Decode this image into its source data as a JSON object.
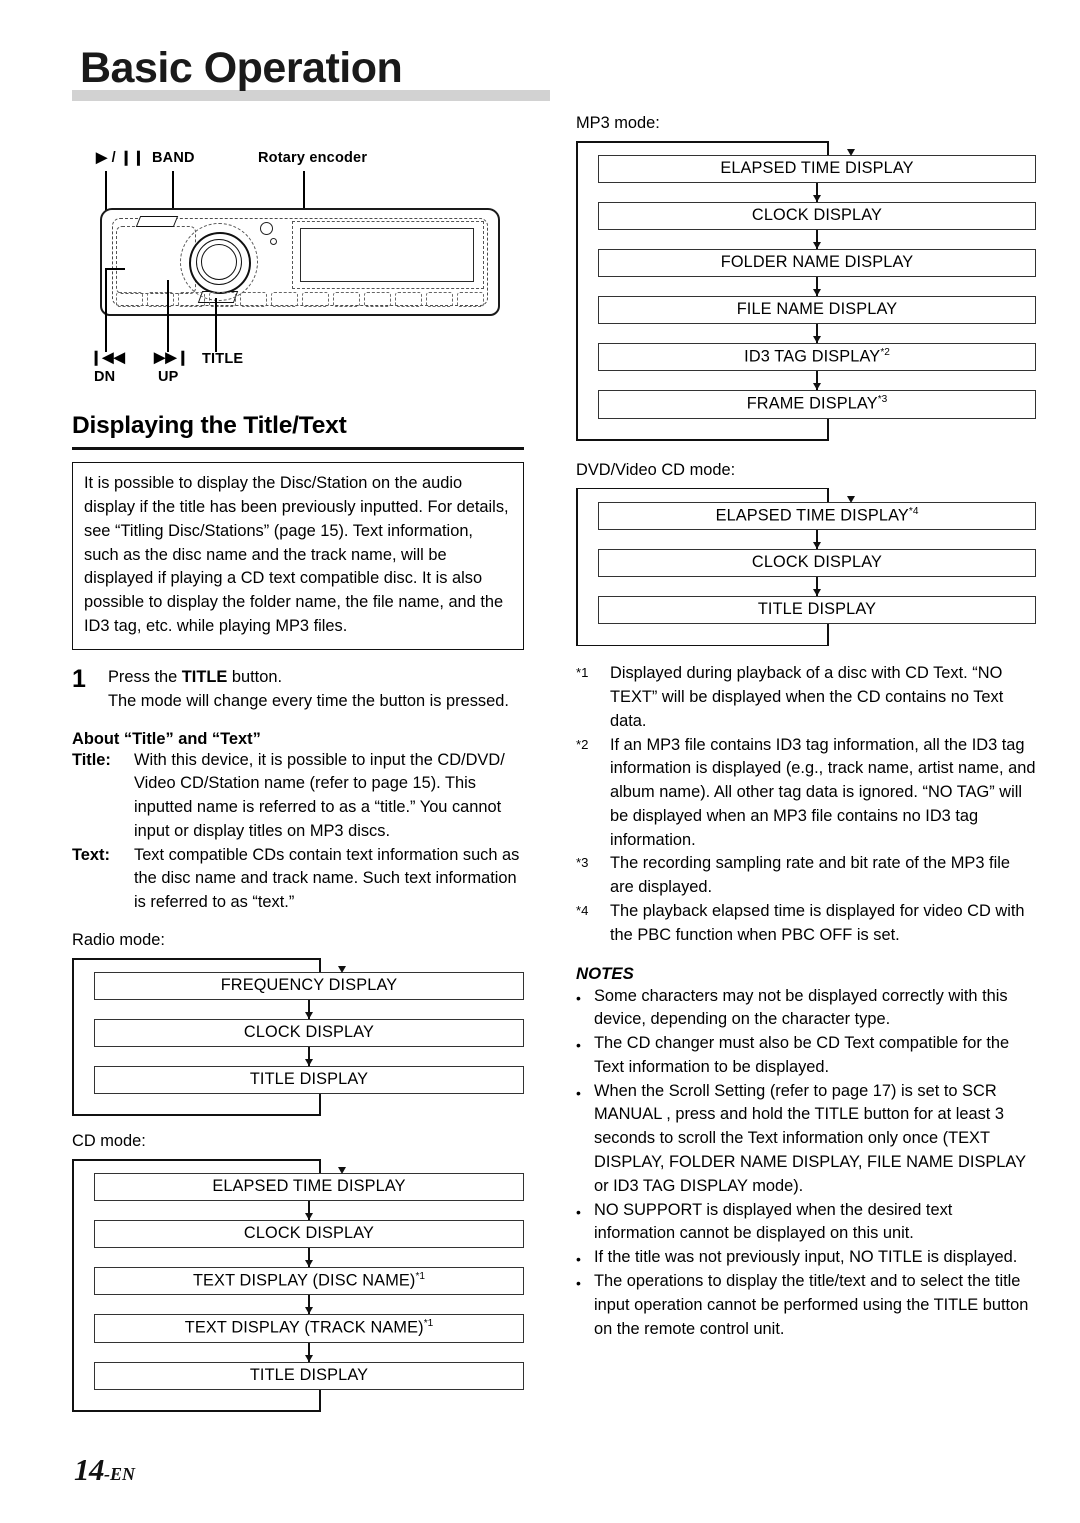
{
  "header": {
    "title": "Basic Operation"
  },
  "figure": {
    "labels": {
      "play_pause": "▶ / ❙❙",
      "band": "BAND",
      "rotary_encoder": "Rotary encoder",
      "prev": "❙◀◀",
      "prev_sub": "DN",
      "next": "▶▶❙",
      "next_sub": "UP",
      "title": "TITLE"
    }
  },
  "section": {
    "heading": "Displaying the Title/Text",
    "intro": "It is possible to display the Disc/Station on the audio display if the title has been previously inputted. For details, see “Titling Disc/Stations” (page 15). Text information, such as the disc name and the track name, will be displayed if playing a CD text compatible disc. It is also possible to display the folder name, the file name, and the ID3 tag, etc. while playing MP3 files."
  },
  "step1": {
    "number": "1",
    "line1_pre": "Press the ",
    "line1_bold": "TITLE",
    "line1_post": " button.",
    "line2": "The mode will change every time the button is pressed."
  },
  "about": {
    "heading": "About “Title” and “Text”",
    "rows": [
      {
        "term": "Title:",
        "desc": "With this device, it is possible to input the CD/DVD/ Video CD/Station name (refer to page 15). This inputted name is referred to as a “title.” You cannot input or display titles on MP3 discs."
      },
      {
        "term": "Text:",
        "desc": "Text compatible CDs contain text information such as the disc name and track name. Such text information is referred to as “text.”"
      }
    ]
  },
  "flows": {
    "radio": {
      "caption": "Radio mode:",
      "boxes": [
        {
          "label": "FREQUENCY DISPLAY",
          "sup": ""
        },
        {
          "label": "CLOCK DISPLAY",
          "sup": ""
        },
        {
          "label": "TITLE DISPLAY",
          "sup": ""
        }
      ]
    },
    "cd": {
      "caption": "CD mode:",
      "boxes": [
        {
          "label": "ELAPSED TIME DISPLAY",
          "sup": ""
        },
        {
          "label": "CLOCK DISPLAY",
          "sup": ""
        },
        {
          "label": "TEXT DISPLAY (DISC NAME)",
          "sup": "*1"
        },
        {
          "label": "TEXT DISPLAY (TRACK NAME)",
          "sup": "*1"
        },
        {
          "label": "TITLE DISPLAY",
          "sup": ""
        }
      ]
    },
    "mp3": {
      "caption": "MP3 mode:",
      "boxes": [
        {
          "label": "ELAPSED TIME DISPLAY",
          "sup": ""
        },
        {
          "label": "CLOCK DISPLAY",
          "sup": ""
        },
        {
          "label": "FOLDER NAME DISPLAY",
          "sup": ""
        },
        {
          "label": "FILE NAME DISPLAY",
          "sup": ""
        },
        {
          "label": "ID3 TAG DISPLAY",
          "sup": "*2"
        },
        {
          "label": "FRAME DISPLAY",
          "sup": "*3"
        }
      ]
    },
    "dvd": {
      "caption": "DVD/Video CD mode:",
      "boxes": [
        {
          "label": "ELAPSED TIME DISPLAY",
          "sup": "*4"
        },
        {
          "label": "CLOCK DISPLAY",
          "sup": ""
        },
        {
          "label": "TITLE DISPLAY",
          "sup": ""
        }
      ]
    }
  },
  "footnotes": [
    {
      "mark": "*1",
      "text": "Displayed during playback of a disc with CD Text. “NO TEXT” will be displayed when the CD contains no Text data."
    },
    {
      "mark": "*2",
      "text": "If an MP3 file contains ID3 tag information, all the ID3 tag information is displayed  (e.g., track name, artist name, and album name). All other tag data is ignored. “NO TAG” will be displayed when an MP3 file contains no ID3 tag information."
    },
    {
      "mark": "*3",
      "text": "The recording sampling rate and bit rate of the MP3 file are displayed."
    },
    {
      "mark": "*4",
      "text": "The playback elapsed time is displayed for video CD with the PBC function when PBC OFF is set."
    }
  ],
  "notes": {
    "title": "NOTES",
    "bullet": "•",
    "items": [
      "Some characters may not be displayed correctly with this device, depending on the character type.",
      "The CD changer must also be CD Text compatible for the Text information to be displayed.",
      "When the Scroll Setting (refer to page 17) is set to  SCR MANUAL , press and hold the TITLE button for at least 3 seconds to scroll the Text information only once (TEXT DISPLAY, FOLDER NAME DISPLAY, FILE NAME DISPLAY or ID3 TAG DISPLAY mode).",
      " NO SUPPORT  is displayed when the desired text information cannot be displayed on this unit.",
      "If the title was not previously input,  NO TITLE  is displayed.",
      "The operations to display the title/text and to select the title input operation cannot be performed using the TITLE button on the remote control unit."
    ]
  },
  "footer": {
    "page": "14",
    "suffix": "-EN"
  }
}
